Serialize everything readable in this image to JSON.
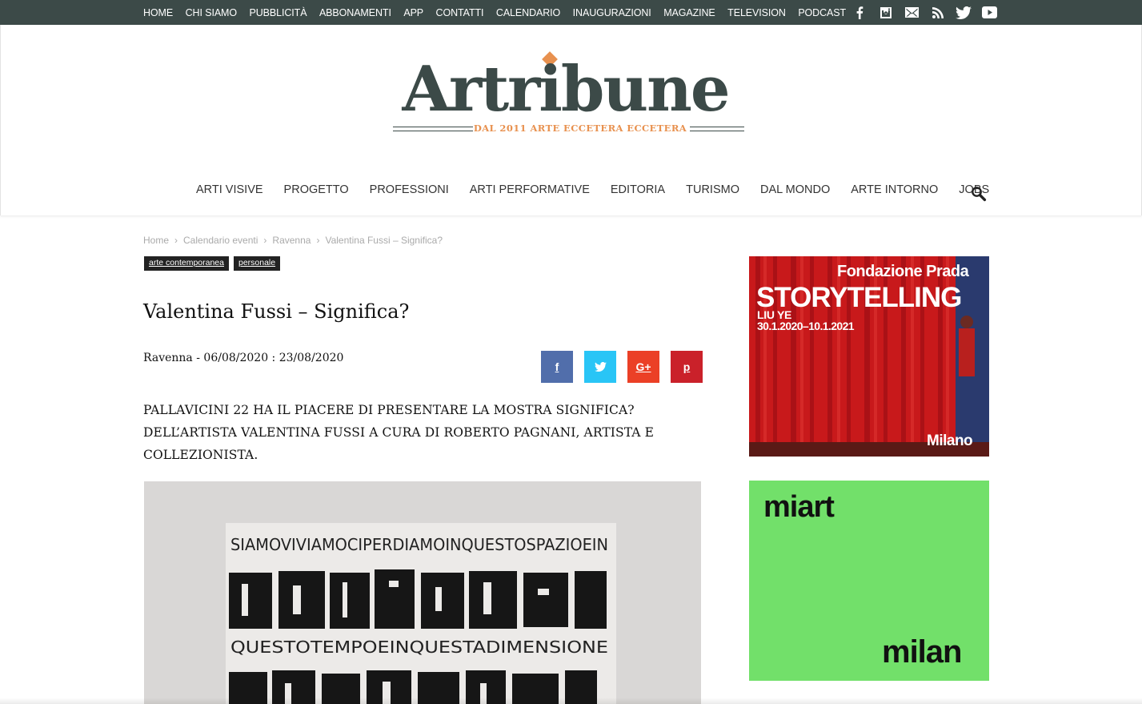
{
  "topnav": {
    "items": [
      "HOME",
      "CHI SIAMO",
      "PUBBLICITÀ",
      "ABBONAMENTI",
      "APP",
      "CONTATTI",
      "CALENDARIO",
      "INAUGURAZIONI",
      "MAGAZINE",
      "TELEVISION",
      "PODCAST"
    ]
  },
  "social_icons": [
    "facebook-icon",
    "instagram-icon",
    "mail-icon",
    "rss-icon",
    "twitter-icon",
    "youtube-icon"
  ],
  "logo": {
    "wordmark": "Artribune",
    "tagline": "DAL 2011 ARTE ECCETERA ECCETERA"
  },
  "mainnav": {
    "items": [
      "ARTI VISIVE",
      "PROGETTO",
      "PROFESSIONI",
      "ARTI PERFORMATIVE",
      "EDITORIA",
      "TURISMO",
      "DAL MONDO",
      "ARTE INTORNO",
      "JOBS"
    ]
  },
  "breadcrumb": [
    "Home",
    "Calendario eventi",
    "Ravenna",
    "Valentina Fussi – Significa?"
  ],
  "tags": [
    "arte contemporanea",
    "personale"
  ],
  "article": {
    "title": "Valentina Fussi – Significa?",
    "meta": "Ravenna - 06/08/2020 : 23/08/2020",
    "lead": "Pallavicini 22 ha il piacere di presentare la mostra Significa? dell’artista Valentina Fussi a cura di Roberto Pagnani, artista e collezionista.",
    "image_text_top": "SIAMOVIVIAMOCIPERDIAMOINQUESTOSPAZIOEIN",
    "image_text_mid": "QUESTOTEMPOEINQUESTADIMENSIONE"
  },
  "share": {
    "facebook": "f",
    "twitter": "t",
    "googleplus": "G+",
    "pinterest": "p"
  },
  "ad1": {
    "brand": "Fondazione Prada",
    "title": "STORYTELLING",
    "artist": "LIU YE",
    "dates": "30.1.2020–10.1.2021",
    "city": "Milano"
  },
  "ad2": {
    "top": "miart",
    "bottom": "milan"
  },
  "colors": {
    "topbar": "#3c4a48",
    "logo": "#3c4a48",
    "accent": "#e8914f",
    "ad1_bg": "#c8191b",
    "ad2_bg": "#72e06a"
  }
}
